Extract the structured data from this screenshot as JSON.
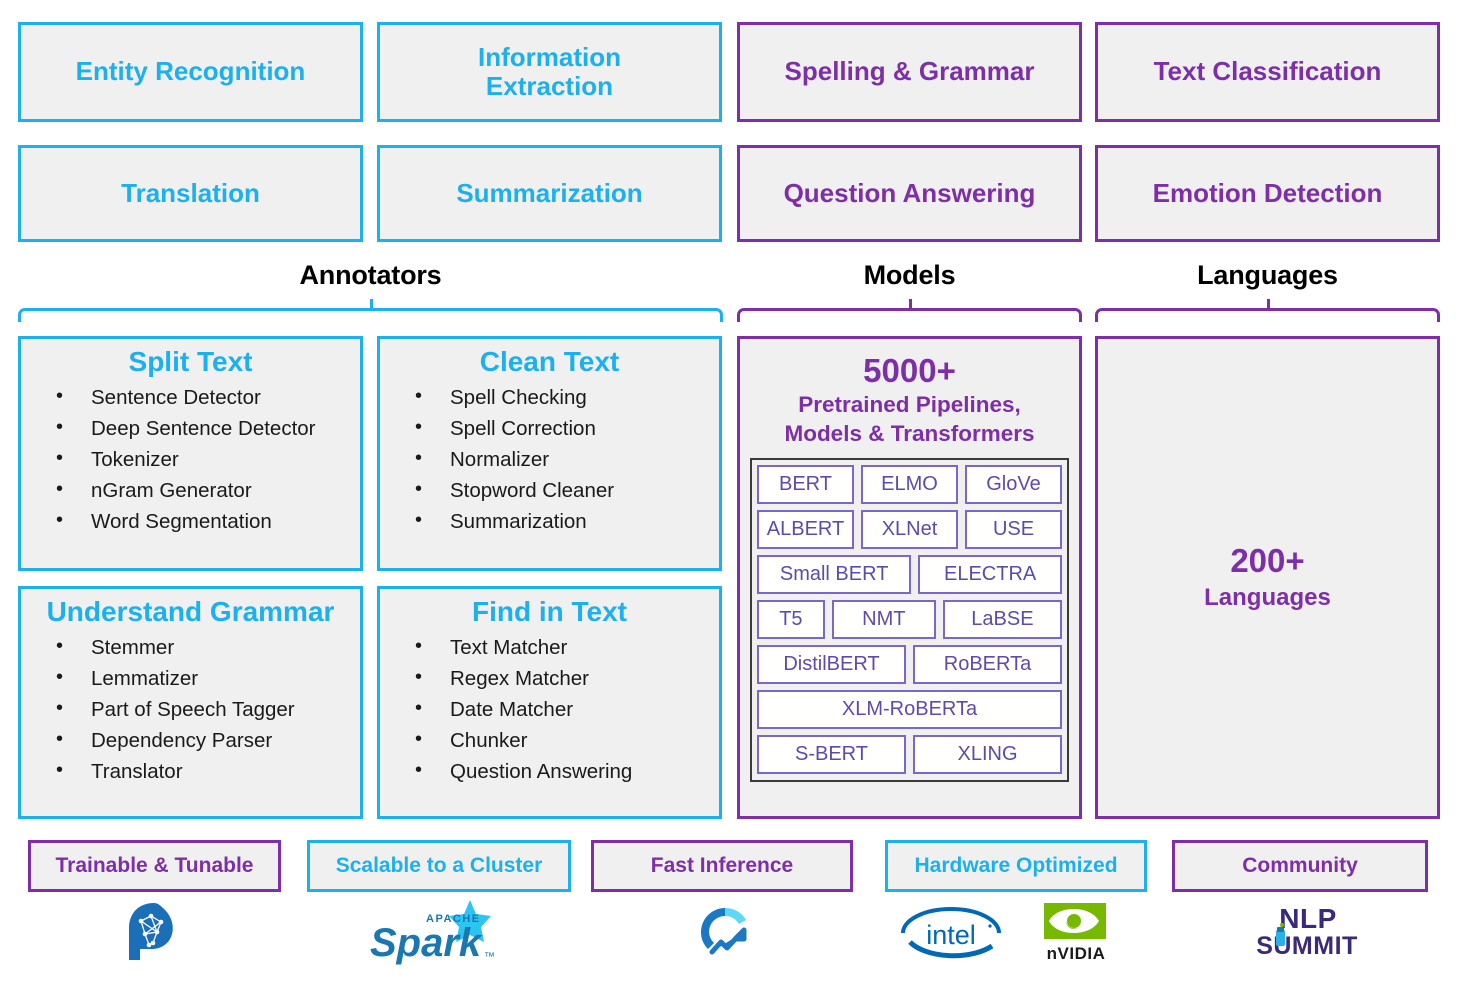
{
  "top_tasks": {
    "blue": [
      {
        "label": "Entity Recognition"
      },
      {
        "label": "Information\nExtraction"
      },
      {
        "label": "Translation"
      },
      {
        "label": "Summarization"
      }
    ],
    "purple": [
      {
        "label": "Spelling & Grammar"
      },
      {
        "label": "Text Classification"
      },
      {
        "label": "Question Answering"
      },
      {
        "label": "Emotion Detection"
      }
    ]
  },
  "sections": {
    "annotators": "Annotators",
    "models": "Models",
    "languages": "Languages"
  },
  "annotators": [
    {
      "title": "Split Text",
      "items": [
        "Sentence Detector",
        "Deep Sentence Detector",
        "Tokenizer",
        "nGram Generator",
        "Word Segmentation"
      ]
    },
    {
      "title": "Clean Text",
      "items": [
        "Spell Checking",
        "Spell Correction",
        "Normalizer",
        "Stopword Cleaner",
        "Summarization"
      ]
    },
    {
      "title": "Understand Grammar",
      "items": [
        "Stemmer",
        "Lemmatizer",
        "Part of Speech Tagger",
        "Dependency Parser",
        "Translator"
      ]
    },
    {
      "title": "Find in Text",
      "items": [
        "Text Matcher",
        "Regex Matcher",
        "Date Matcher",
        "Chunker",
        "Question Answering"
      ]
    }
  ],
  "models": {
    "count": "5000+",
    "subtitle_line1": "Pretrained Pipelines,",
    "subtitle_line2": "Models & Transformers",
    "tag_rows": [
      [
        {
          "label": "BERT",
          "flex": 1
        },
        {
          "label": "ELMO",
          "flex": 1
        },
        {
          "label": "GloVe",
          "flex": 1
        }
      ],
      [
        {
          "label": "ALBERT",
          "flex": 1
        },
        {
          "label": "XLNet",
          "flex": 1
        },
        {
          "label": "USE",
          "flex": 1
        }
      ],
      [
        {
          "label": "Small BERT",
          "flex": 1.08
        },
        {
          "label": "ELECTRA",
          "flex": 1
        }
      ],
      [
        {
          "label": "T5",
          "flex": 0.52
        },
        {
          "label": "NMT",
          "flex": 0.86
        },
        {
          "label": "LaBSE",
          "flex": 1
        }
      ],
      [
        {
          "label": "DistilBERT",
          "flex": 1
        },
        {
          "label": "RoBERTa",
          "flex": 1
        }
      ],
      [
        {
          "label": "XLM-RoBERTa",
          "flex": 1
        }
      ],
      [
        {
          "label": "S-BERT",
          "flex": 1
        },
        {
          "label": "XLING",
          "flex": 1
        }
      ]
    ]
  },
  "languages": {
    "count": "200+",
    "label": "Languages"
  },
  "bottom_features": [
    {
      "label": "Trainable & Tunable",
      "color": "purple",
      "logo": "brain-head-icon",
      "logo_text": ""
    },
    {
      "label": "Scalable to a Cluster",
      "color": "blue",
      "logo": "apache-spark-logo",
      "logo_text": "Spark"
    },
    {
      "label": "Fast Inference",
      "color": "blue-purple",
      "logo": "speed-gauge-icon",
      "logo_text": ""
    },
    {
      "label": "Hardware Optimized",
      "color": "blue",
      "logo": "intel-nvidia-logos",
      "logo_text": "intel"
    },
    {
      "label": "Community",
      "color": "purple",
      "logo": "nlp-summit-logo",
      "logo_text": "NLP SUMMIT"
    }
  ],
  "logo_labels": {
    "spark_apache": "APACHE",
    "spark_name": "Spark",
    "intel": "intel",
    "nvidia": "nVIDIA",
    "nlp": "NLP",
    "summit": "SUMMIT"
  },
  "colors": {
    "blue": "#1cb0ee",
    "purple": "#7d2ea8",
    "tag_purple": "#5b4bad",
    "panel_bg": "#f0f0f0",
    "nvidia_green": "#76b900",
    "intel_blue": "#0068b5",
    "spark_blue": "#1b78af"
  }
}
